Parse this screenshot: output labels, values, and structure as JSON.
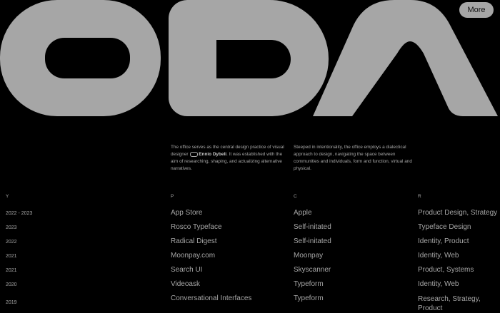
{
  "header": {
    "more_label": "More"
  },
  "intro": {
    "left_before": "The office serves as the central design practice of visual designer ",
    "left_name": "Ennio Dybeli",
    "left_after": ". It was established with the aim of researching, shaping, and actualizing alternative narratives.",
    "right": "Steeped in intentionality, the office employs a dialectical approach to design, navigating the space between communities and individuals, form and function, virtual and physical."
  },
  "table": {
    "headers": [
      "Y",
      "P",
      "C",
      "R"
    ],
    "rows": [
      {
        "year": "2022 - 2023",
        "project": "App Store",
        "client": "Apple",
        "role": "Product Design, Strategy"
      },
      {
        "year": "2023",
        "project": "Rosco Typeface",
        "client": "Self-initated",
        "role": "Typeface Design"
      },
      {
        "year": "2022",
        "project": "Radical Digest",
        "client": "Self-initated",
        "role": "Identity, Product"
      },
      {
        "year": "2021",
        "project": "Moonpay.com",
        "client": "Moonpay",
        "role": "Identity, Web"
      },
      {
        "year": "2021",
        "project": "Search UI",
        "client": "Skyscanner",
        "role": "Product, Systems"
      },
      {
        "year": "2020",
        "project": "Videoask",
        "client": "Typeform",
        "role": "Identity, Web"
      },
      {
        "year": "2019",
        "project": "Conversational Interfaces",
        "client": "Typeform",
        "role": "Research, Strategy, Product"
      }
    ]
  },
  "colors": {
    "background": "#000000",
    "foreground": "#a6a6a6"
  }
}
